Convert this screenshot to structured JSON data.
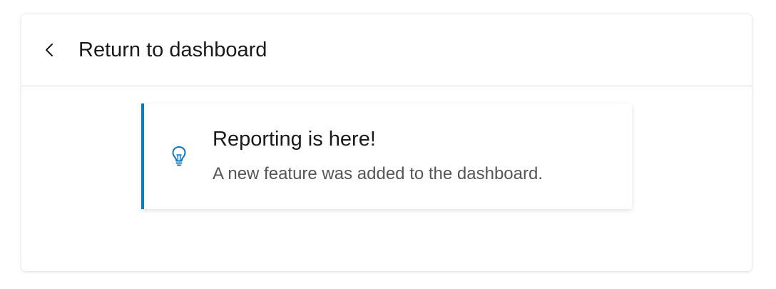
{
  "header": {
    "back_icon": "chevron-left-icon",
    "title": "Return to dashboard"
  },
  "notification": {
    "icon": "lightbulb-icon",
    "accent_color": "#0f78c2",
    "title": "Reporting is here!",
    "message": "A new feature was added to the dashboard."
  }
}
